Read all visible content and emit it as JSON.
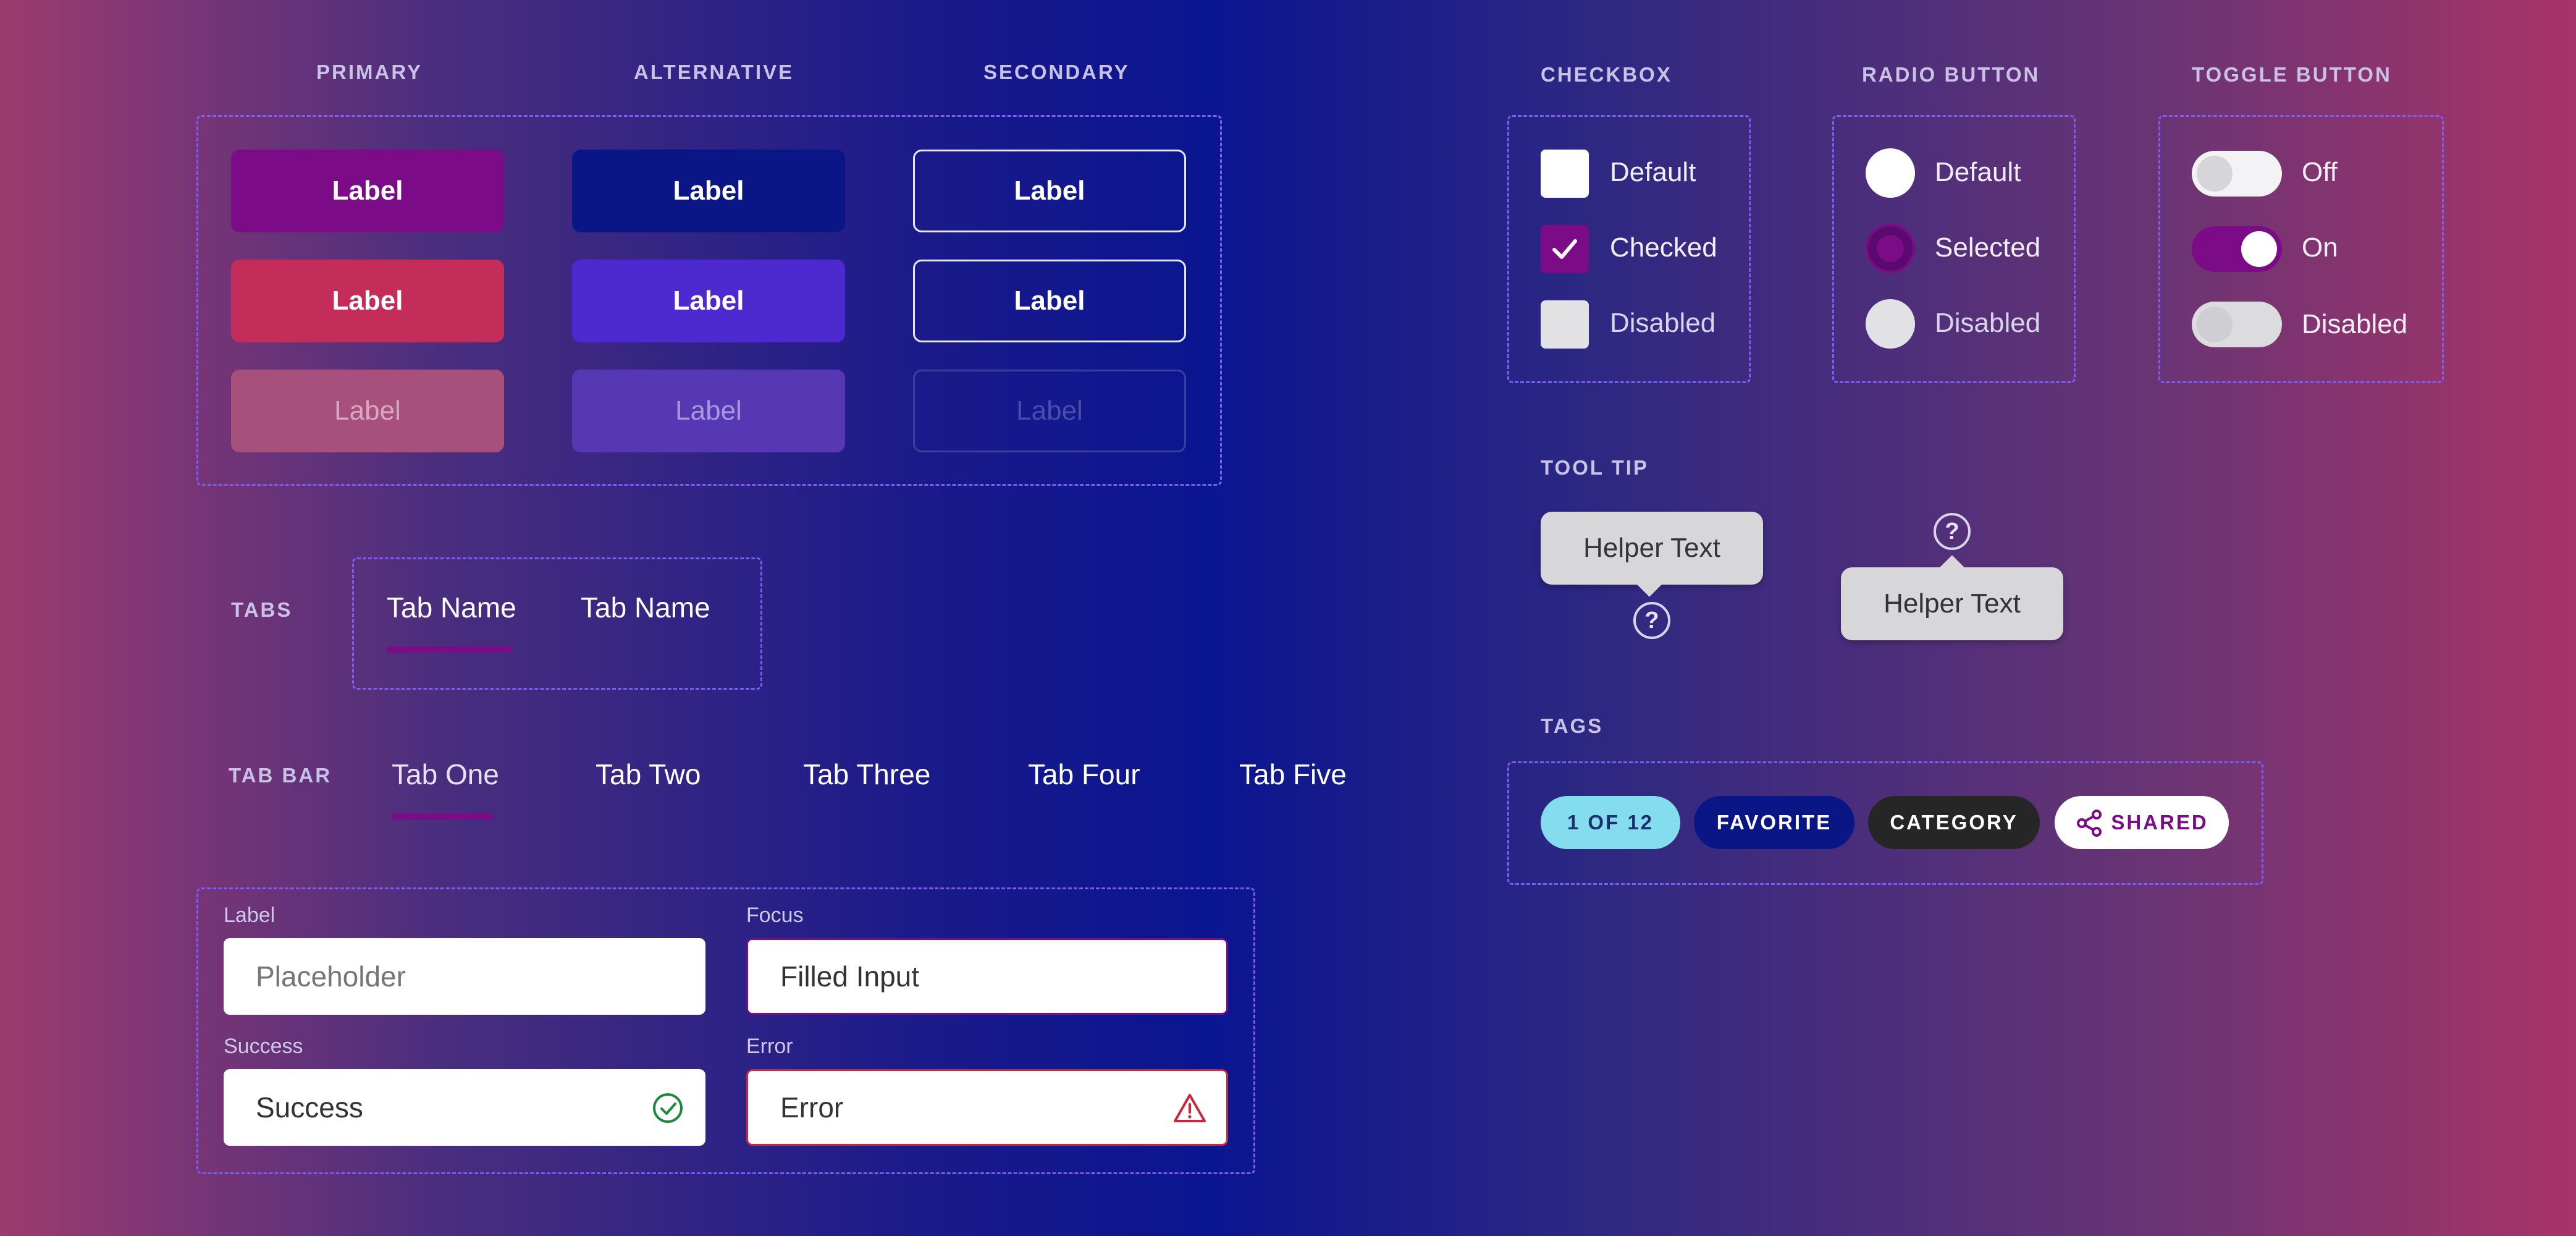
{
  "buttons": {
    "headings": {
      "primary": "PRIMARY",
      "alternative": "ALTERNATIVE",
      "secondary": "SECONDARY"
    },
    "label": "Label"
  },
  "tabs": {
    "heading": "TABS",
    "items": [
      "Tab Name",
      "Tab Name"
    ]
  },
  "tab_bar": {
    "heading": "TAB BAR",
    "items": [
      "Tab One",
      "Tab Two",
      "Tab Three",
      "Tab Four",
      "Tab Five"
    ]
  },
  "inputs": {
    "label_field": {
      "label": "Label",
      "placeholder": "Placeholder"
    },
    "focus_field": {
      "label": "Focus",
      "value": "Filled Input"
    },
    "success_field": {
      "label": "Success",
      "value": "Success"
    },
    "error_field": {
      "label": "Error",
      "value": "Error"
    }
  },
  "checkbox": {
    "heading": "CHECKBOX",
    "options": [
      "Default",
      "Checked",
      "Disabled"
    ]
  },
  "radio": {
    "heading": "RADIO BUTTON",
    "options": [
      "Default",
      "Selected",
      "Disabled"
    ]
  },
  "toggle": {
    "heading": "TOGGLE BUTTON",
    "options": [
      "Off",
      "On",
      "Disabled"
    ]
  },
  "tooltip": {
    "heading": "TOOL TIP",
    "text": "Helper Text",
    "icon": "?"
  },
  "tags": {
    "heading": "TAGS",
    "items": [
      "1 OF 12",
      "FAVORITE",
      "CATEGORY",
      "SHARED"
    ]
  },
  "colors": {
    "primary": "#7b0b86",
    "primary_hover": "#c42c5a",
    "primary_disabled": "#a8507c",
    "alternative": "#0b1686",
    "alternative_hover": "#4c2ad0",
    "alternative_disabled": "#5738b4",
    "dashed_border": "#7d5cf2",
    "success": "#1b8a3a",
    "error": "#d0243a",
    "tag_cyan": "#84dcef"
  }
}
